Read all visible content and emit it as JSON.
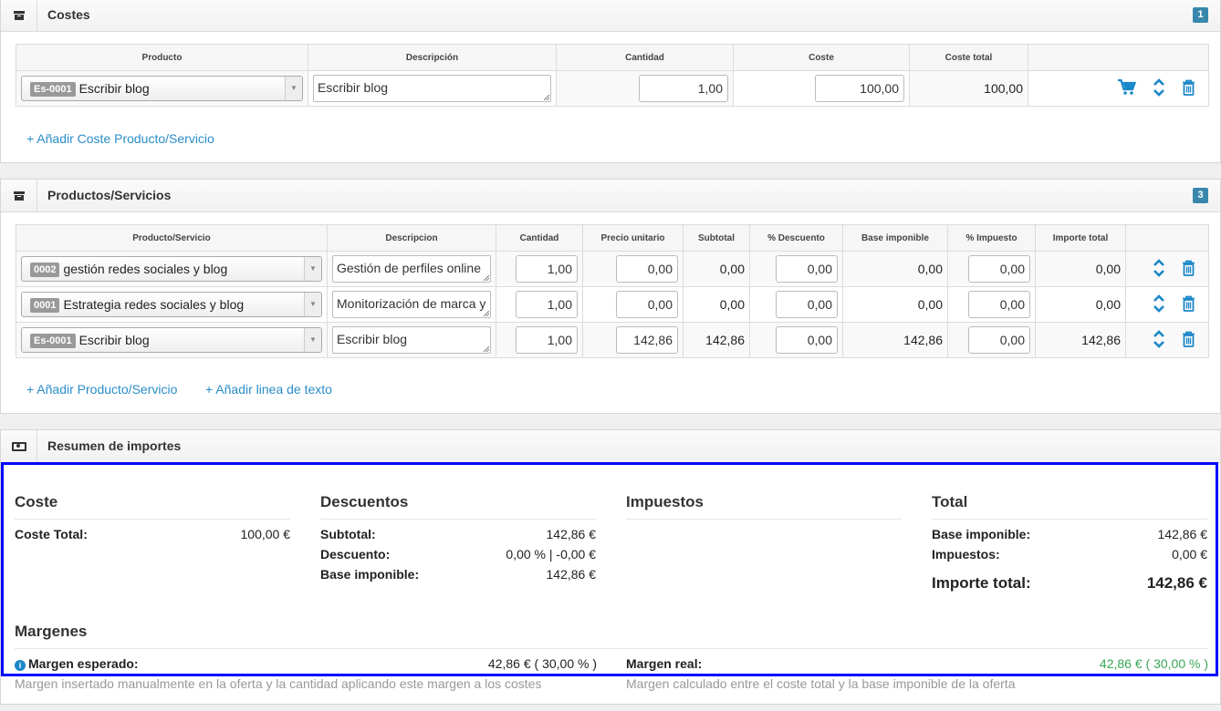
{
  "costes": {
    "title": "Costes",
    "badge": "1",
    "headers": [
      "Producto",
      "Descripción",
      "Cantidad",
      "Coste",
      "Coste total",
      ""
    ],
    "rows": [
      {
        "code": "Es-0001",
        "product": "Escribir blog",
        "description": "Escribir blog",
        "cantidad": "1,00",
        "coste": "100,00",
        "coste_total": "100,00"
      }
    ],
    "add_link": "+ Añadir Coste Producto/Servicio"
  },
  "productos": {
    "title": "Productos/Servicios",
    "badge": "3",
    "headers": [
      "Producto/Servicio",
      "Descripcion",
      "Cantidad",
      "Precio unitario",
      "Subtotal",
      "% Descuento",
      "Base imponible",
      "% Impuesto",
      "Importe total",
      ""
    ],
    "rows": [
      {
        "code": "0002",
        "product": "gestión redes sociales y blog",
        "description": "Gestión de perfiles online",
        "cantidad": "1,00",
        "precio": "0,00",
        "subtotal": "0,00",
        "descuento": "0,00",
        "base": "0,00",
        "impuesto": "0,00",
        "importe": "0,00"
      },
      {
        "code": "0001",
        "product": "Estrategia redes sociales y blog",
        "description": "Monitorización de marca y",
        "cantidad": "1,00",
        "precio": "0,00",
        "subtotal": "0,00",
        "descuento": "0,00",
        "base": "0,00",
        "impuesto": "0,00",
        "importe": "0,00"
      },
      {
        "code": "Es-0001",
        "product": "Escribir blog",
        "description": "Escribir blog",
        "cantidad": "1,00",
        "precio": "142,86",
        "subtotal": "142,86",
        "descuento": "0,00",
        "base": "142,86",
        "impuesto": "0,00",
        "importe": "142,86"
      }
    ],
    "add_link": "+ Añadir Producto/Servicio",
    "add_text_link": "+ Añadir linea de texto"
  },
  "resumen": {
    "title": "Resumen de importes",
    "coste": {
      "heading": "Coste",
      "total_label": "Coste Total:",
      "total_value": "100,00 €"
    },
    "descuentos": {
      "heading": "Descuentos",
      "subtotal_label": "Subtotal:",
      "subtotal_value": "142,86 €",
      "descuento_label": "Descuento:",
      "descuento_value": "0,00 % | -0,00 €",
      "base_label": "Base imponible:",
      "base_value": "142,86 €"
    },
    "impuestos": {
      "heading": "Impuestos"
    },
    "total": {
      "heading": "Total",
      "base_label": "Base imponible:",
      "base_value": "142,86 €",
      "impuestos_label": "Impuestos:",
      "impuestos_value": "0,00 €",
      "importe_label": "Importe total:",
      "importe_value": "142,86 €"
    },
    "margenes": {
      "heading": "Margenes",
      "esperado_label": "Margen esperado:",
      "esperado_value": "42,86 € ( 30,00 % )",
      "esperado_help": "Margen insertado manualmente en la oferta y la cantidad aplicando este margen a los costes",
      "real_label": "Margen real:",
      "real_value": "42,86 € ( 30,00 % )",
      "real_help": "Margen calculado entre el coste total y la base imponible de la oferta"
    }
  },
  "colors": {
    "link": "#2a8dc8",
    "badge": "#3a87ad",
    "positive": "#3aa757",
    "highlight_border": "#0000ff"
  }
}
